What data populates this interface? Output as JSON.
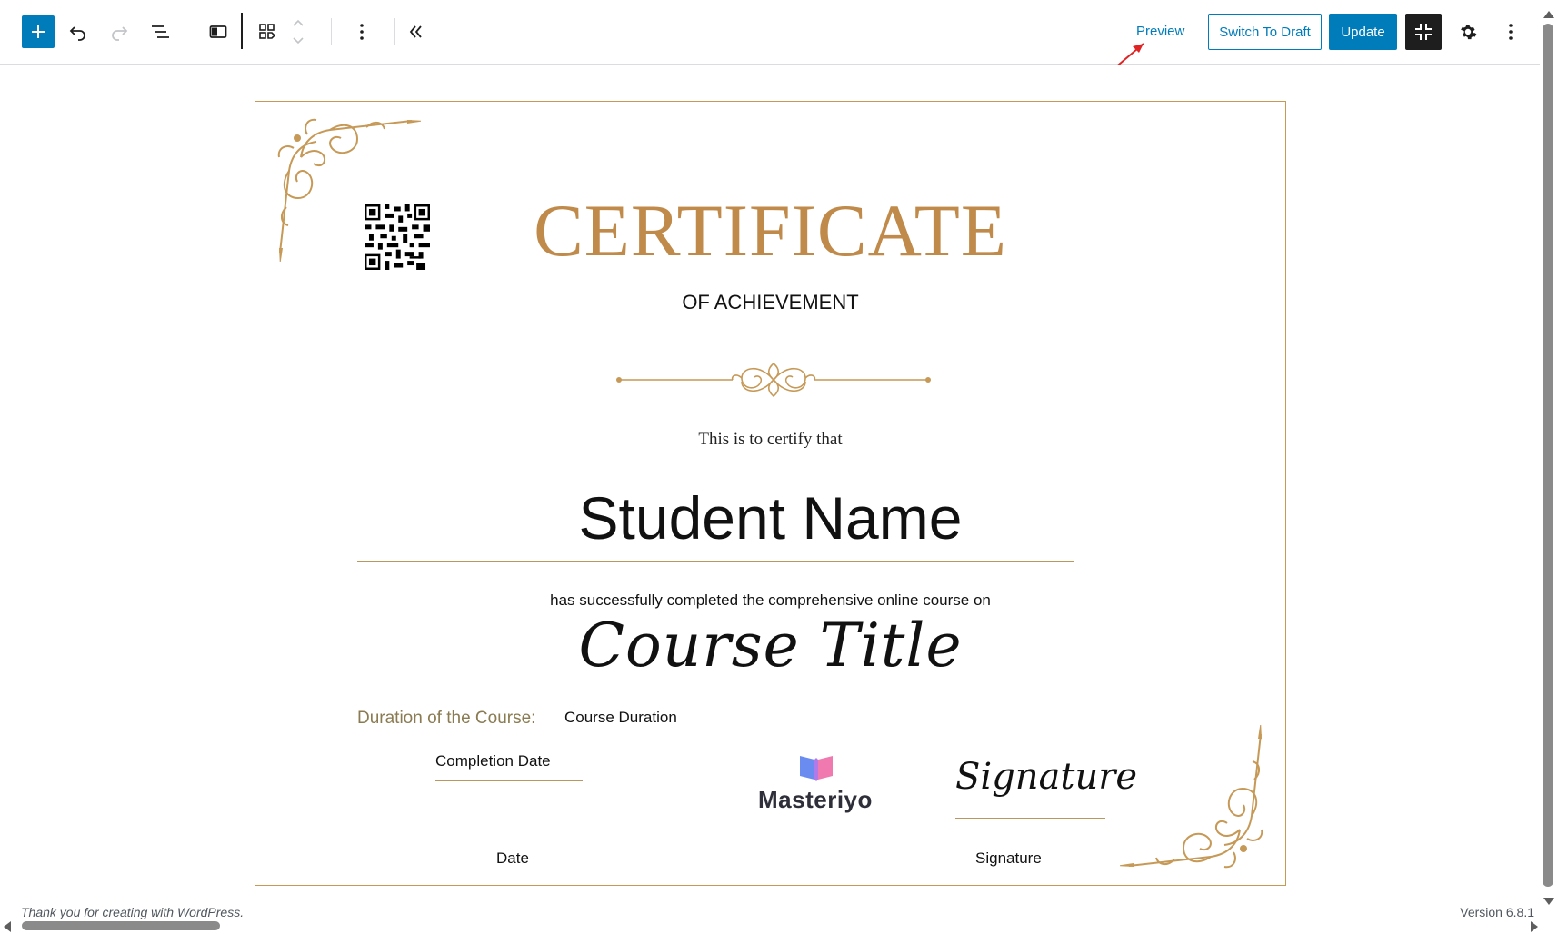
{
  "toolbar": {
    "preview_label": "Preview",
    "switch_draft_label": "Switch To Draft",
    "update_label": "Update"
  },
  "certificate": {
    "title": "CERTIFICATE",
    "subtitle": "OF ACHIEVEMENT",
    "certify_text": "This is to certify that",
    "student_name": "Student Name",
    "completed_text": "has successfully completed the comprehensive online course on",
    "course_title": "Course Title",
    "duration_label": "Duration of the Course:",
    "duration_value": "Course Duration",
    "completion_date": "Completion Date",
    "logo_text": "Masteriyo",
    "signature_script": "Signature",
    "date_label": "Date",
    "signature_label": "Signature"
  },
  "footer": {
    "left": "Thank you for creating with WordPress.",
    "right": "Version 6.8.1"
  },
  "colors": {
    "accent": "#007cba",
    "gold": "#c08a4a",
    "dark": "#1e1e1e",
    "annotation": "#e02424"
  },
  "icons": [
    "plus-icon",
    "undo-icon",
    "redo-icon",
    "list-view-icon",
    "block-toggle-icon",
    "group-icon",
    "move-arrows-icon",
    "more-vertical-icon",
    "collapse-icon",
    "exit-fullscreen-icon",
    "gear-icon",
    "options-icon"
  ]
}
